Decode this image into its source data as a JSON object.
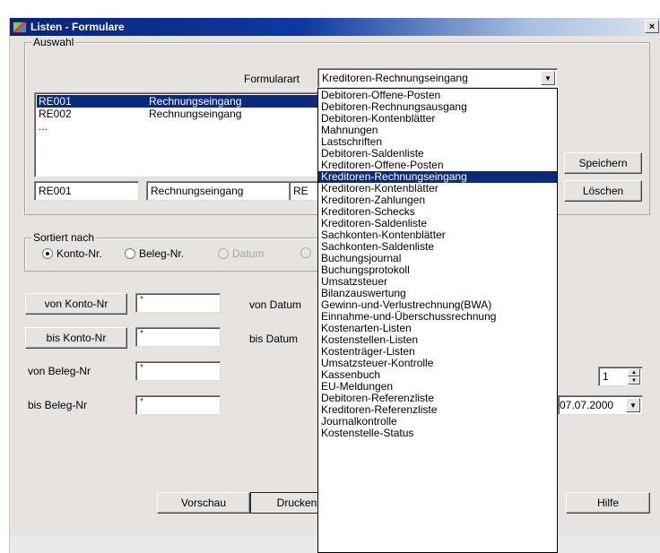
{
  "window": {
    "title": "Listen - Formulare",
    "close_label": "×"
  },
  "auswahl": {
    "group_title": "Auswahl",
    "formularart_label": "Formularart",
    "formularart_value": "Kreditoren-Rechnungseingang",
    "list": [
      {
        "code": "RE001",
        "name": "Rechnungseingang",
        "selected": true
      },
      {
        "code": "RE002",
        "name": "Rechnungseingang",
        "selected": false
      },
      {
        "code": "...",
        "name": "",
        "selected": false
      }
    ],
    "code_field": "RE001",
    "name_field": "Rechnungseingang",
    "partial_field": "RE",
    "save_label": "Speichern",
    "delete_label": "Löschen"
  },
  "sort": {
    "group_title": "Sortiert nach",
    "options": [
      {
        "label": "Konto-Nr.",
        "checked": true,
        "disabled": false
      },
      {
        "label": "Beleg-Nr.",
        "checked": false,
        "disabled": false
      },
      {
        "label": "Datum",
        "checked": false,
        "disabled": true
      }
    ]
  },
  "filters": {
    "von_konto_label": "von Konto-Nr",
    "von_konto_value": "*",
    "bis_konto_label": "bis Konto-Nr",
    "bis_konto_value": "*",
    "von_beleg_label": "von Beleg-Nr",
    "von_beleg_value": "*",
    "bis_beleg_label": "bis Beleg-Nr",
    "bis_beleg_value": "*",
    "von_datum_label": "von Datum",
    "bis_datum_label": "bis Datum",
    "spin_value": "1",
    "date_value": "07.07.2000"
  },
  "buttons": {
    "preview": "Vorschau",
    "print": "Drucken",
    "help": "Hilfe"
  },
  "dropdown": {
    "items": [
      "Debitoren-Offene-Posten",
      "Debitoren-Rechnungsausgang",
      "Debitoren-Kontenblätter",
      "Mahnungen",
      "Lastschriften",
      "Debitoren-Saldenliste",
      "Kreditoren-Offene-Posten",
      "Kreditoren-Rechnungseingang",
      "Kreditoren-Kontenblätter",
      "Kreditoren-Zahlungen",
      "Kreditoren-Schecks",
      "Kreditoren-Saldenliste",
      "Sachkonten-Kontenblätter",
      "Sachkonten-Saldenliste",
      "Buchungsjournal",
      "Buchungsprotokoll",
      "Umsatzsteuer",
      "Bilanzauswertung",
      "Gewinn-und-Verlustrechnung(BWA)",
      "Einnahme-und-Überschussrechnung",
      "Kostenarten-Listen",
      "Kostenstellen-Listen",
      "Kostenträger-Listen",
      "Umsatzsteuer-Kontrolle",
      "Kassenbuch",
      "EU-Meldungen",
      "Debitoren-Referenzliste",
      "Kreditoren-Referenzliste",
      "Journalkontrolle",
      "Kostenstelle-Status"
    ],
    "selected_index": 7
  },
  "colors": {
    "title_bar": "#0b3aa0",
    "selection": "#0b2a7e",
    "dialog_bg": "#e6e3e0"
  }
}
